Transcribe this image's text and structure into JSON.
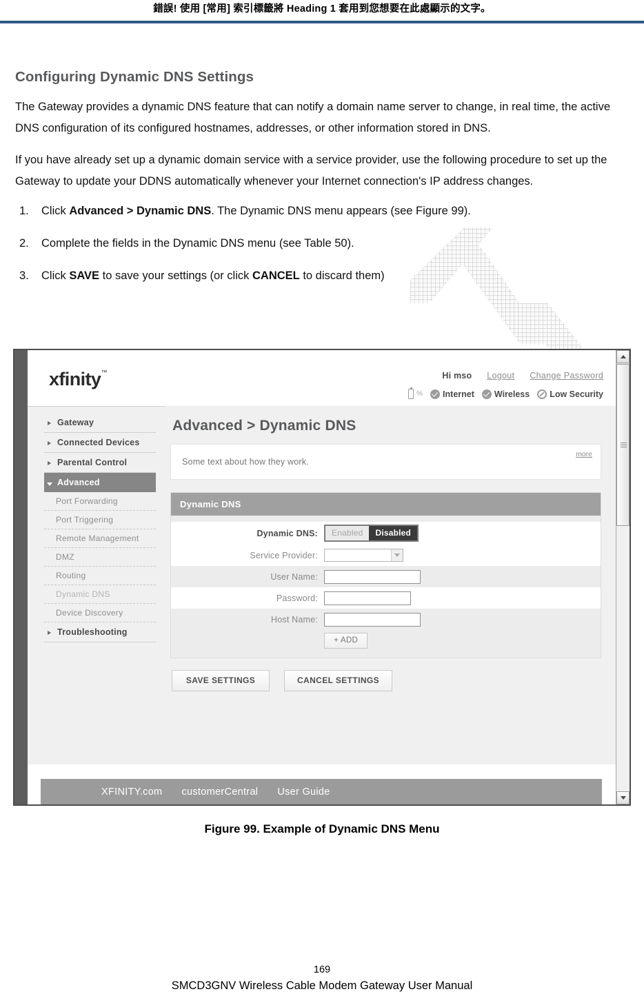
{
  "doc": {
    "running_header": "錯誤! 使用 [常用] 索引標籤將 Heading 1 套用到您想要在此處顯示的文字。",
    "header_rule_color": "#2e5a87",
    "section_title": "Configuring Dynamic DNS Settings",
    "paragraphs": [
      "The Gateway provides a dynamic DNS feature that can notify a domain name server to change, in real time, the active DNS configuration of its configured hostnames, addresses, or other information stored in DNS.",
      "If you have already set up a dynamic domain service with a service provider, use the following procedure to set up the Gateway to update your DDNS automatically whenever your Internet connection's IP address changes."
    ],
    "steps": [
      {
        "num": "1.",
        "parts": [
          {
            "text": "Click ",
            "bold": false
          },
          {
            "text": "Advanced > Dynamic DNS",
            "bold": true
          },
          {
            "text": ". The Dynamic DNS menu appears (see Figure 99).",
            "bold": false
          }
        ]
      },
      {
        "num": "2.",
        "parts": [
          {
            "text": "Complete the fields in the Dynamic DNS menu (see Table 50).",
            "bold": false
          }
        ]
      },
      {
        "num": "3.",
        "parts": [
          {
            "text": "Click ",
            "bold": false
          },
          {
            "text": "SAVE",
            "bold": true
          },
          {
            "text": " to save your settings (or click ",
            "bold": false
          },
          {
            "text": "CANCEL",
            "bold": true
          },
          {
            "text": " to discard them)",
            "bold": false
          }
        ]
      }
    ],
    "figure_caption": "Figure 99. Example of Dynamic DNS Menu",
    "footer": {
      "page_number": "169",
      "manual_title": "SMCD3GNV Wireless Cable Modem Gateway User Manual"
    }
  },
  "screenshot": {
    "brand": {
      "name": "xfinity",
      "trademark": "™"
    },
    "account": {
      "greeting": "Hi mso",
      "logout": "Logout",
      "change_password": "Change Password"
    },
    "status": {
      "battery_icon": "battery-icon",
      "battery_percent": "%",
      "items": [
        {
          "icon": "check-circle-icon",
          "label": "Internet"
        },
        {
          "icon": "check-circle-icon",
          "label": "Wireless"
        },
        {
          "icon": "alert-circle-icon",
          "label": "Low Security"
        }
      ]
    },
    "sidebar": {
      "items": [
        {
          "label": "Gateway",
          "type": "top",
          "state": "collapsed"
        },
        {
          "label": "Connected Devices",
          "type": "top",
          "state": "collapsed"
        },
        {
          "label": "Parental Control",
          "type": "top",
          "state": "collapsed"
        },
        {
          "label": "Advanced",
          "type": "top",
          "state": "expanded"
        },
        {
          "label": "Port Forwarding",
          "type": "sub"
        },
        {
          "label": "Port Triggering",
          "type": "sub"
        },
        {
          "label": "Remote Management",
          "type": "sub"
        },
        {
          "label": "DMZ",
          "type": "sub"
        },
        {
          "label": "Routing",
          "type": "sub"
        },
        {
          "label": "Dynamic DNS",
          "type": "sub",
          "current": true
        },
        {
          "label": "Device Discovery",
          "type": "sub"
        },
        {
          "label": "Troubleshooting",
          "type": "top",
          "state": "collapsed"
        }
      ]
    },
    "main": {
      "page_title": "Advanced > Dynamic DNS",
      "info_text": "Some text about how they work.",
      "more_label": "more",
      "panel_title": "Dynamic DNS",
      "fields": {
        "dynamic_dns_label": "Dynamic DNS:",
        "toggle_enabled": "Enabled",
        "toggle_disabled": "Disabled",
        "toggle_selected": "Disabled",
        "service_provider_label": "Service Provider:",
        "service_provider_value": "",
        "user_name_label": "User Name:",
        "user_name_value": "",
        "password_label": "Password:",
        "password_value": "",
        "host_name_label": "Host Name:",
        "host_name_value": "",
        "add_label": "+ ADD"
      },
      "save_label": "SAVE SETTINGS",
      "cancel_label": "CANCEL SETTINGS"
    },
    "footer_links": [
      "XFINITY.com",
      "customerCentral",
      "User Guide"
    ],
    "colors": {
      "panel_head": "#a0a0a0",
      "active_nav": "#868686",
      "footer_bar": "#9b9b9b",
      "body_bg": "#f0f0f0",
      "toggle_on": "#3a3a3a"
    }
  }
}
